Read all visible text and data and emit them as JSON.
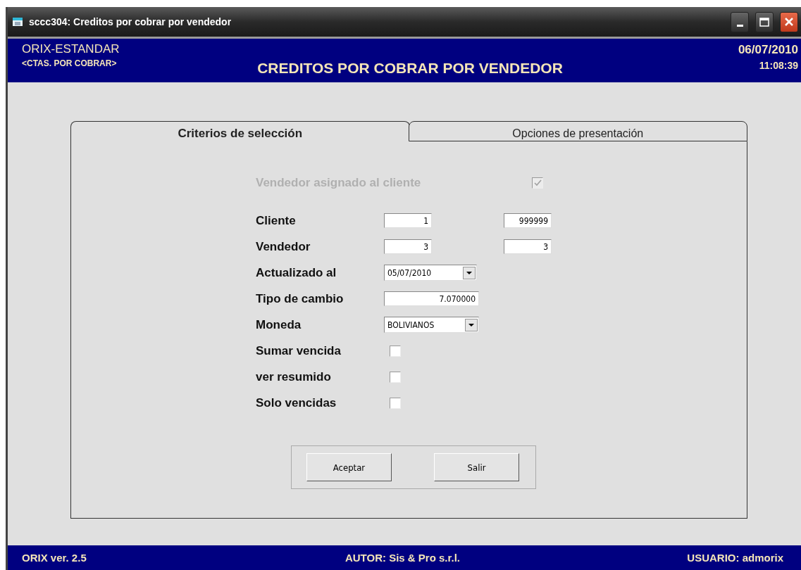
{
  "window": {
    "title": "sccc304: Creditos por cobrar por vendedor"
  },
  "header": {
    "app": "ORIX-ESTANDAR",
    "module": "<CTAS. POR COBRAR>",
    "title": "CREDITOS POR COBRAR POR VENDEDOR",
    "date": "06/07/2010",
    "time": "11:08:39"
  },
  "tabs": [
    {
      "label": "Criterios de selección",
      "selected": true
    },
    {
      "label": "Opciones de presentación",
      "selected": false
    }
  ],
  "assigned_seller": {
    "label": "Vendedor asignado al cliente",
    "checked": true,
    "disabled": true
  },
  "rows": [
    {
      "kind": "range",
      "label": "Cliente",
      "from": "1",
      "to": "999999"
    },
    {
      "kind": "range",
      "label": "Vendedor",
      "from": "3",
      "to": "3"
    },
    {
      "kind": "dropdown",
      "label": "Actualizado al",
      "value": "05/07/2010"
    },
    {
      "kind": "text",
      "label": "Tipo de cambio",
      "value": "7.070000"
    },
    {
      "kind": "select",
      "label": "Moneda",
      "value": "BOLIVIANOS"
    },
    {
      "kind": "checkbox",
      "label": "Sumar vencida",
      "checked": false
    },
    {
      "kind": "checkbox",
      "label": "ver resumido",
      "checked": false
    },
    {
      "kind": "checkbox",
      "label": "Solo vencidas",
      "checked": false
    }
  ],
  "buttons": [
    "Aceptar",
    "Salir"
  ],
  "status_bar": {
    "version": "ORIX ver. 2.5",
    "author": "AUTOR: Sis & Pro s.r.l.",
    "user": "USUARIO: admorix"
  }
}
